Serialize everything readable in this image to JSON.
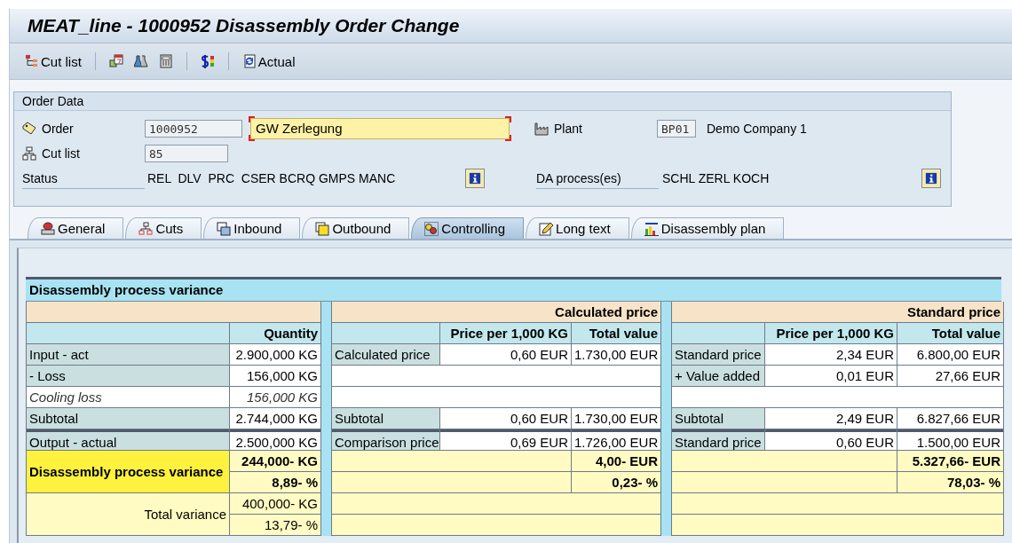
{
  "window": {
    "title": "MEAT_line - 1000952 Disassembly Order Change"
  },
  "toolbar": [
    {
      "kind": "button",
      "label": "Cut list"
    },
    {
      "kind": "separator"
    },
    {
      "kind": "icon"
    },
    {
      "kind": "icon"
    },
    {
      "kind": "icon"
    },
    {
      "kind": "separator"
    },
    {
      "kind": "icon"
    },
    {
      "kind": "separator"
    },
    {
      "kind": "button",
      "label": "Actual"
    }
  ],
  "order_data": {
    "title": "Order Data",
    "order": {
      "label": "Order",
      "value": "1000952",
      "description": "GW Zerlegung",
      "description_focused": true
    },
    "cut_list": {
      "label": "Cut list",
      "value": "85"
    },
    "plant": {
      "label": "Plant",
      "value": "BP01",
      "name": "Demo Company 1"
    },
    "status": {
      "label": "Status",
      "value": "REL  DLV  PRC  CSER BCRQ GMPS MANC"
    },
    "da_process": {
      "label": "DA process(es)",
      "value": "SCHL ZERL KOCH"
    }
  },
  "tabs": [
    {
      "label": "General",
      "selected": false
    },
    {
      "label": "Cuts",
      "selected": false
    },
    {
      "label": "Inbound",
      "selected": false
    },
    {
      "label": "Outbound",
      "selected": false
    },
    {
      "label": "Controlling",
      "selected": true
    },
    {
      "label": "Long text",
      "selected": false
    },
    {
      "label": "Disassembly plan",
      "selected": false
    }
  ],
  "variance_table": {
    "title": "Disassembly process variance",
    "sections": [
      {
        "columns": [
          "",
          "Quantity"
        ],
        "rows": [
          {
            "kind": "line",
            "cells": [
              "Input - act",
              "2.900,000 KG"
            ]
          },
          {
            "kind": "line",
            "cells": [
              "- Loss",
              "156,000 KG"
            ]
          },
          {
            "kind": "detail",
            "cells": [
              "Cooling loss",
              "156,000 KG"
            ]
          },
          {
            "kind": "line",
            "cells": [
              "Subtotal",
              "2.744,000 KG"
            ]
          },
          {
            "kind": "comparison",
            "cells": [
              "Output - actual",
              "2.500,000 KG"
            ]
          },
          {
            "kind": "variance",
            "label": "Disassembly process variance",
            "values": [
              "244,000- KG",
              "8,89- %"
            ]
          },
          {
            "kind": "total",
            "label": "Total variance",
            "values": [
              "400,000- KG",
              "13,79- %"
            ]
          }
        ]
      },
      {
        "header": "Calculated price",
        "columns": [
          "",
          "Price per 1,000 KG",
          "Total value"
        ],
        "rows": [
          {
            "kind": "line",
            "cells": [
              "Calculated price",
              "0,60 EUR",
              "1.730,00 EUR"
            ]
          },
          {
            "kind": "blank"
          },
          {
            "kind": "blank"
          },
          {
            "kind": "line",
            "cells": [
              "Subtotal",
              "0,60 EUR",
              "1.730,00 EUR"
            ]
          },
          {
            "kind": "comparison",
            "cells": [
              "Comparison price",
              "0,69 EUR",
              "1.726,00 EUR"
            ]
          },
          {
            "kind": "result",
            "value": "4,00- EUR"
          },
          {
            "kind": "result",
            "value": "0,23- %"
          },
          {
            "kind": "empty"
          },
          {
            "kind": "empty"
          }
        ]
      },
      {
        "header": "Standard price",
        "columns": [
          "",
          "Price per 1,000 KG",
          "Total value"
        ],
        "rows": [
          {
            "kind": "line",
            "cells": [
              "Standard price",
              "2,34 EUR",
              "6.800,00 EUR"
            ]
          },
          {
            "kind": "line",
            "cells": [
              "+ Value added",
              "0,01 EUR",
              "27,66 EUR"
            ]
          },
          {
            "kind": "blank"
          },
          {
            "kind": "line",
            "cells": [
              "Subtotal",
              "2,49 EUR",
              "6.827,66 EUR"
            ]
          },
          {
            "kind": "comparison",
            "cells": [
              "Standard price",
              "0,60 EUR",
              "1.500,00 EUR"
            ]
          },
          {
            "kind": "result",
            "value": "5.327,66- EUR"
          },
          {
            "kind": "result",
            "value": "78,03- %"
          },
          {
            "kind": "empty"
          },
          {
            "kind": "empty"
          }
        ]
      }
    ]
  }
}
